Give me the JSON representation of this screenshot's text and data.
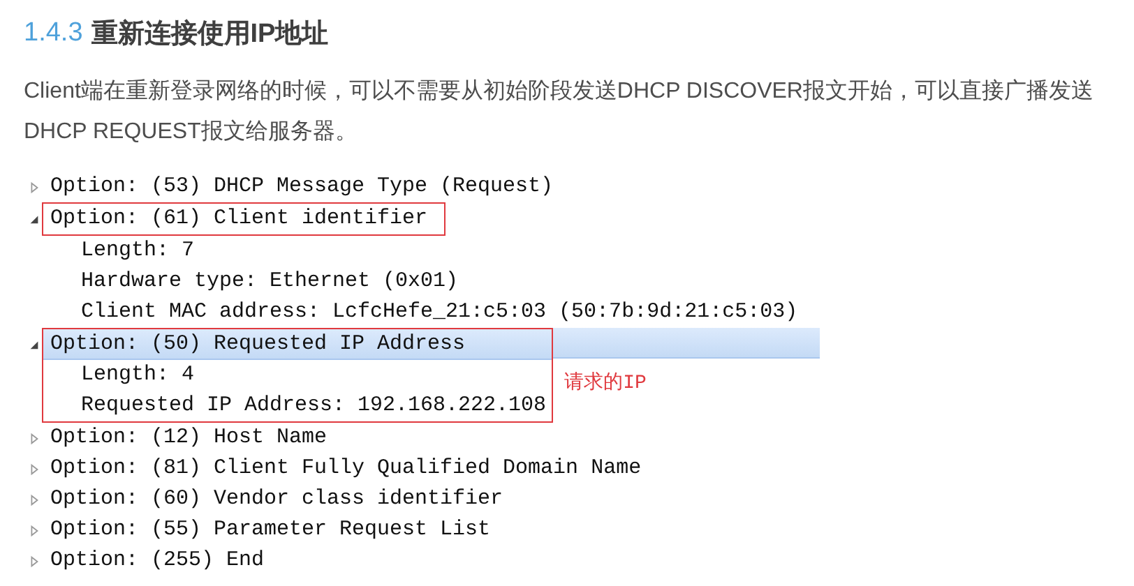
{
  "heading": {
    "number": "1.4.3",
    "title": "重新连接使用IP地址"
  },
  "paragraph": "Client端在重新登录网络的时候，可以不需要从初始阶段发送DHCP DISCOVER报文开始，可以直接广播发送DHCP REQUEST报文给服务器。",
  "tree": [
    {
      "kind": "plain",
      "label": "Option: (53) DHCP Message Type (Request)",
      "expanded": false,
      "selected": false
    },
    {
      "kind": "boxed",
      "label": "Option: (61) Client identifier",
      "expanded": true,
      "selected": false,
      "children": [
        {
          "label": "Length: 7"
        },
        {
          "label": "Hardware type: Ethernet (0x01)"
        },
        {
          "label": "Client MAC address: LcfcHefe_21:c5:03 (50:7b:9d:21:c5:03)"
        }
      ]
    },
    {
      "kind": "boxedgroup",
      "label": "Option: (50) Requested IP Address",
      "expanded": true,
      "selected": true,
      "note": "请求的IP",
      "children": [
        {
          "label": "Length: 4"
        },
        {
          "label": "Requested IP Address: 192.168.222.108"
        }
      ]
    },
    {
      "kind": "plain",
      "label": "Option: (12) Host Name",
      "expanded": false,
      "selected": false
    },
    {
      "kind": "plain",
      "label": "Option: (81) Client Fully Qualified Domain Name",
      "expanded": false,
      "selected": false
    },
    {
      "kind": "plain",
      "label": "Option: (60) Vendor class identifier",
      "expanded": false,
      "selected": false
    },
    {
      "kind": "plain",
      "label": "Option: (55) Parameter Request List",
      "expanded": false,
      "selected": false
    },
    {
      "kind": "plain",
      "label": "Option: (255) End",
      "expanded": false,
      "selected": false
    }
  ]
}
